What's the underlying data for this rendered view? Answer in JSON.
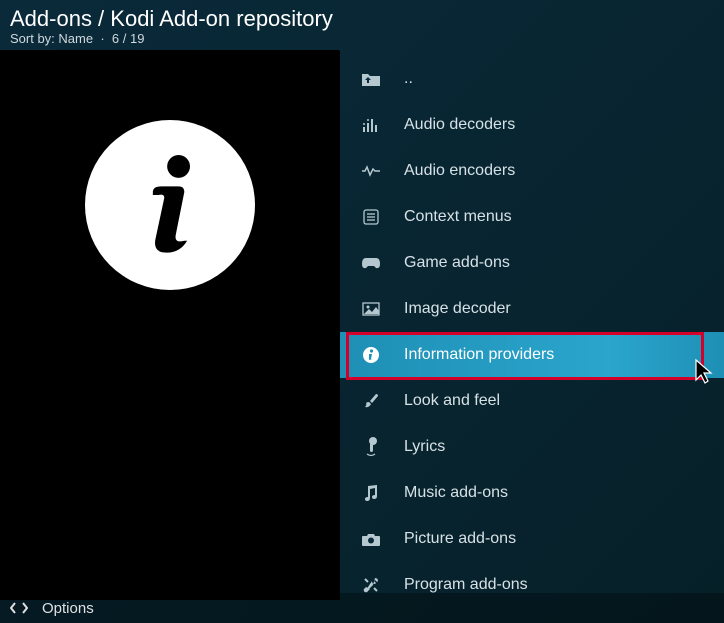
{
  "header": {
    "breadcrumb": "Add-ons / Kodi Add-on repository",
    "sort_by_label": "Sort by:",
    "sort_by_value": "Name",
    "position": "6 / 19"
  },
  "list": {
    "items": [
      {
        "icon": "folder-up-icon",
        "label": ".."
      },
      {
        "icon": "equalizer-icon",
        "label": "Audio decoders"
      },
      {
        "icon": "waveform-icon",
        "label": "Audio encoders"
      },
      {
        "icon": "menu-icon",
        "label": "Context menus"
      },
      {
        "icon": "gamepad-icon",
        "label": "Game add-ons"
      },
      {
        "icon": "image-icon",
        "label": "Image decoder"
      },
      {
        "icon": "info-icon",
        "label": "Information providers"
      },
      {
        "icon": "brush-icon",
        "label": "Look and feel"
      },
      {
        "icon": "microphone-icon",
        "label": "Lyrics"
      },
      {
        "icon": "music-note-icon",
        "label": "Music add-ons"
      },
      {
        "icon": "camera-icon",
        "label": "Picture add-ons"
      },
      {
        "icon": "tools-icon",
        "label": "Program add-ons"
      }
    ],
    "selected_index": 6
  },
  "footer": {
    "options_label": "Options"
  }
}
